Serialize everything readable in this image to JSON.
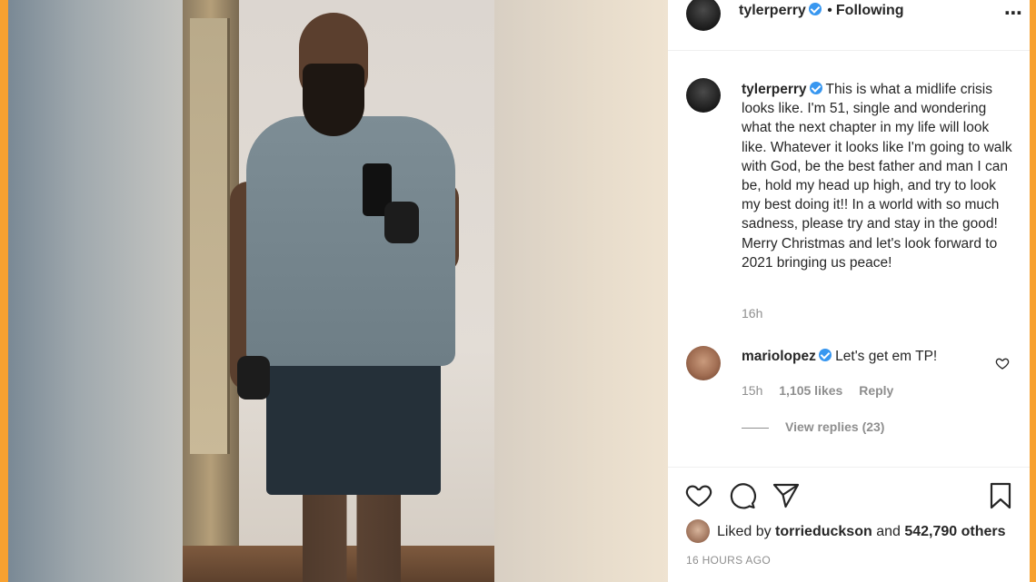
{
  "post": {
    "author": "tylerperry",
    "follow_state": "Following",
    "header_separator": "•",
    "more_icon": "⋯",
    "caption": "This is what a midlife crisis looks like. I'm 51, single and wondering what the next chapter in my life will look like. Whatever it looks like I'm going to walk with God, be the best father and man I can be, hold my head up high, and try to look my best doing it!! In a world with so much sadness, please try and stay in the good! Merry Christmas and let's look forward to 2021 bringing us peace!",
    "caption_time": "16h",
    "age": "16 HOURS AGO"
  },
  "comment": {
    "author": "mariolopez",
    "text": "Let's get em TP!",
    "time": "15h",
    "likes": "1,105 likes",
    "reply_label": "Reply",
    "view_replies": "View replies (23)"
  },
  "likes": {
    "prefix": "Liked by",
    "user": "torrieduckson",
    "joiner": "and",
    "others": "542,790 others"
  },
  "icons": [
    "heart-icon",
    "comment-icon",
    "share-icon",
    "bookmark-icon",
    "verified-badge-icon",
    "more-icon"
  ],
  "colors": {
    "accent_border": "#f7a130",
    "verified_blue": "#3897f0",
    "text_primary": "#262626",
    "text_secondary": "#8e8e8e"
  }
}
